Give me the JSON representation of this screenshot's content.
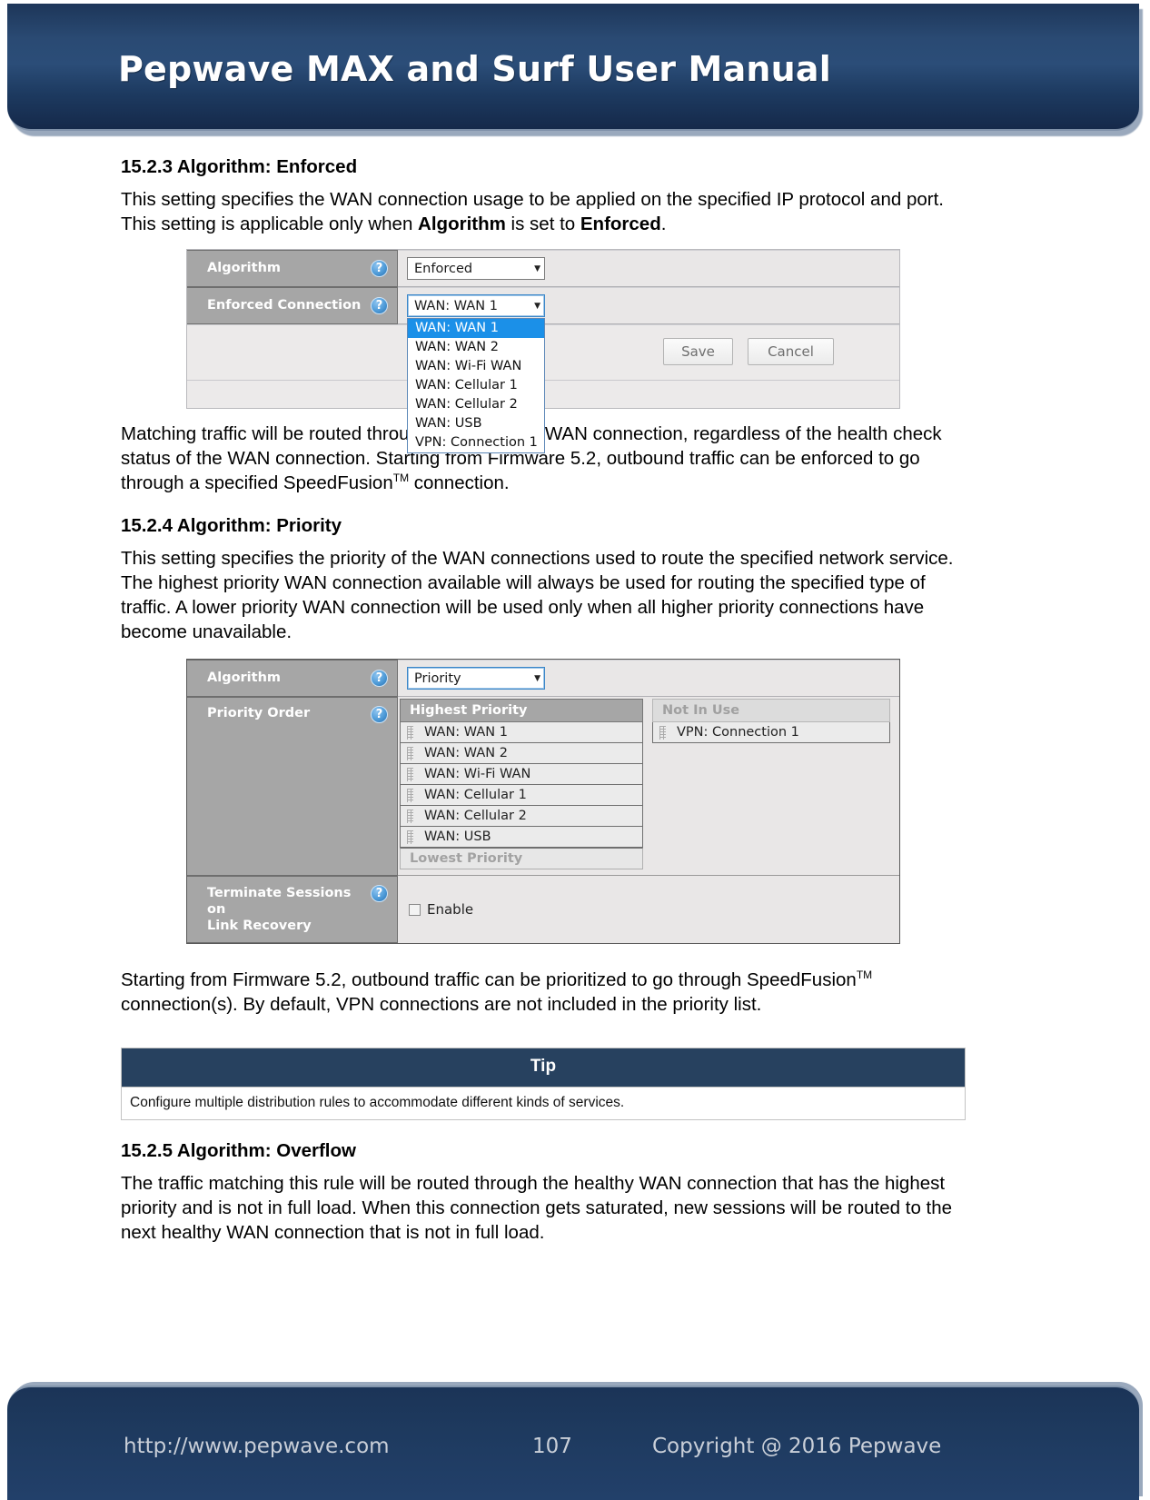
{
  "header": {
    "title": "Pepwave MAX and Surf User Manual"
  },
  "sections": {
    "enforced": {
      "heading": "15.2.3 Algorithm: Enforced",
      "para_a": "This setting specifies the WAN connection usage to be applied on the specified IP protocol and port. This setting is applicable only when ",
      "para_bold1": "Algorithm",
      "para_b": " is set to ",
      "para_bold2": "Enforced",
      "para_c": ".",
      "after_shot": {
        "part1": "Matching traffic will be routed through the specified WAN connection, regardless of the health check status of the WAN connection. Starting from Firmware 5.2, outbound traffic can be enforced to go through a specified SpeedFusion",
        "tm": "TM",
        "part2": " connection."
      }
    },
    "priority": {
      "heading": "15.2.4 Algorithm: Priority",
      "para": "This setting specifies the priority of the WAN connections used to route the specified network service. The highest priority WAN connection available will always be used for routing the specified type of traffic. A lower priority WAN connection will be used only when all higher priority connections have become unavailable.",
      "after_shot": {
        "part1": "Starting from Firmware 5.2, outbound traffic can be prioritized to go through SpeedFusion",
        "tm": "TM",
        "part2": " connection(s). By default, VPN connections are not included in the priority list."
      }
    },
    "overflow": {
      "heading": "15.2.5 Algorithm: Overflow",
      "para": "The traffic matching this rule will be routed through the healthy WAN connection that has the highest priority and is not in full load. When this connection gets saturated, new sessions will be routed to the next healthy WAN connection that is not in full load."
    }
  },
  "screenshot_enforced": {
    "rows": [
      {
        "label": "Algorithm",
        "help_icon": "?",
        "value": "Enforced"
      },
      {
        "label": "Enforced Connection",
        "help_icon": "?",
        "value": "WAN: WAN 1"
      }
    ],
    "dropdown_options": [
      "WAN: WAN 1",
      "WAN: WAN 2",
      "WAN: Wi-Fi WAN",
      "WAN: Cellular 1",
      "WAN: Cellular 2",
      "WAN: USB",
      "VPN: Connection 1"
    ],
    "dropdown_selected_index": 0,
    "buttons": {
      "save": "Save",
      "cancel": "Cancel"
    },
    "caret_glyph": "▼"
  },
  "screenshot_priority": {
    "algorithm_label": "Algorithm",
    "algorithm_value": "Priority",
    "priority_order_label": "Priority Order",
    "in_use_header": "Highest Priority",
    "in_use_footer": "Lowest Priority",
    "in_use_items": [
      "WAN: WAN 1",
      "WAN: WAN 2",
      "WAN: Wi-Fi WAN",
      "WAN: Cellular 1",
      "WAN: Cellular 2",
      "WAN: USB"
    ],
    "not_in_use_header": "Not In Use",
    "not_in_use_items": [
      "VPN: Connection 1"
    ],
    "terminate_label_line1": "Terminate Sessions on",
    "terminate_label_line2": "Link Recovery",
    "terminate_checkbox_label": "Enable",
    "terminate_checked": false,
    "help_icon": "?",
    "caret_glyph": "▼"
  },
  "tip": {
    "title": "Tip",
    "body": "Configure multiple distribution rules to accommodate different kinds of services."
  },
  "footer": {
    "url": "http://www.pepwave.com",
    "page": "107",
    "copyright": "Copyright @ 2016 Pepwave"
  },
  "colors": {
    "banner_dark": "#1d3659",
    "banner_mid": "#2b4d78",
    "tip_header": "#27415f",
    "ui_label_gray": "#a6a6a6",
    "dropdown_highlight": "#1b90e8"
  }
}
